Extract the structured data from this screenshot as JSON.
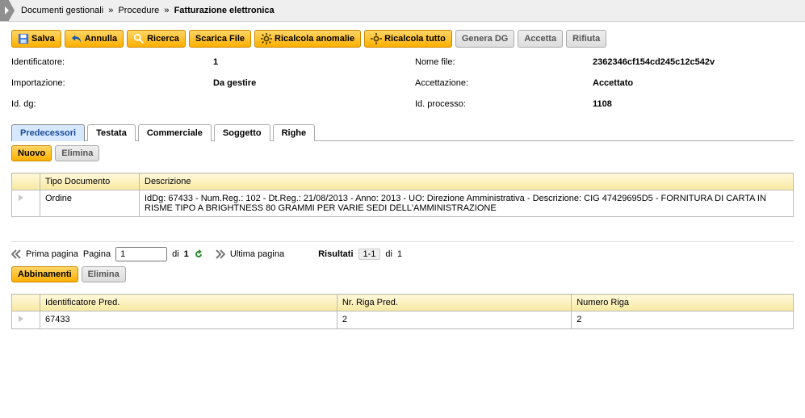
{
  "breadcrumb": {
    "a": "Documenti gestionali",
    "b": "Procedure",
    "c": "Fatturazione elettronica"
  },
  "toolbar": {
    "salva": "Salva",
    "annulla": "Annulla",
    "ricerca": "Ricerca",
    "scarica": "Scarica File",
    "ric_anom": "Ricalcola anomalie",
    "ric_tutto": "Ricalcola tutto",
    "genera": "Genera DG",
    "accetta": "Accetta",
    "rifiuta": "Rifiuta"
  },
  "fields": {
    "identificatore_l": "Identificatore:",
    "identificatore_v": "1",
    "nomefile_l": "Nome file:",
    "nomefile_v": "2362346cf154cd245c12c542v",
    "importazione_l": "Importazione:",
    "importazione_v": "Da gestire",
    "accettazione_l": "Accettazione:",
    "accettazione_v": "Accettato",
    "iddg_l": "Id. dg:",
    "iddg_v": "",
    "idproc_l": "Id. processo:",
    "idproc_v": "1108"
  },
  "tabs": {
    "predecessori": "Predecessori",
    "testata": "Testata",
    "commerciale": "Commerciale",
    "soggetto": "Soggetto",
    "righe": "Righe"
  },
  "sub": {
    "nuovo": "Nuovo",
    "elimina": "Elimina",
    "abbinamenti": "Abbinamenti"
  },
  "pred": {
    "h1": "Tipo Documento",
    "h2": "Descrizione",
    "r1_tipo": "Ordine",
    "r1_desc": "IdDg: 67433 - Num.Reg.: 102 - Dt.Reg.: 21/08/2013 - Anno: 2013 - UO: Direzione Amministrativa - Descrizione: CIG 47429695D5 - FORNITURA DI CARTA IN RISME TIPO A BRIGHTNESS 80 GRAMMI PER VARIE SEDI DELL'AMMINISTRAZIONE"
  },
  "pager": {
    "prima": "Prima pagina",
    "pagina": "Pagina",
    "di": "di",
    "totpag": "1",
    "curpag": "1",
    "ultima": "Ultima pagina",
    "risultati": "Risultati",
    "range": "1-1",
    "tot": "1"
  },
  "abb": {
    "h1": "Identificatore Pred.",
    "h2": "Nr. Riga Pred.",
    "h3": "Numero Riga",
    "v1": "67433",
    "v2": "2",
    "v3": "2"
  }
}
